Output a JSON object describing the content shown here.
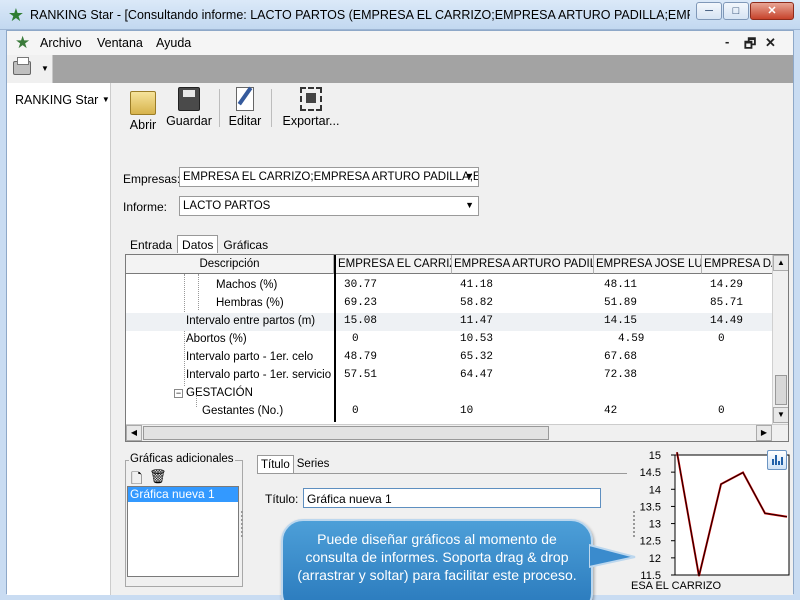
{
  "window": {
    "title": "RANKING Star - [Consultando informe: LACTO PARTOS (EMPRESA EL CARRIZO;EMPRESA ARTURO PADILLA;EMPRESA JOS...",
    "minimize": "─",
    "maximize": "□",
    "close": "✕"
  },
  "menu": {
    "items": [
      "Archivo",
      "Ventana",
      "Ayuda"
    ],
    "mdi_restore": "🗗",
    "mdi_close": "✕"
  },
  "left_panel": {
    "label": "RANKING Star"
  },
  "toolbar": {
    "open_label": "Abrir",
    "save_label": "Guardar",
    "edit_label": "Editar",
    "export_label": "Exportar..."
  },
  "form": {
    "empresas_label": "Empresas:",
    "empresas_value": "EMPRESA EL CARRIZO;EMPRESA ARTURO PADILLA;EMPRI",
    "informe_label": "Informe:",
    "informe_value": "LACTO PARTOS"
  },
  "tabs": [
    "Entrada",
    "Datos",
    "Gráficas"
  ],
  "active_tab": "Datos",
  "grid": {
    "columns": [
      "Descripción",
      "EMPRESA EL CARRIZO",
      "EMPRESA ARTURO PADILLA",
      "EMPRESA JOSE LUIS",
      "EMPRESA DAN"
    ],
    "rows": [
      {
        "desc": "Machos (%)",
        "values": [
          "30.77",
          "41.18",
          "48.11",
          "14.29"
        ]
      },
      {
        "desc": "Hembras (%)",
        "values": [
          "69.23",
          "58.82",
          "51.89",
          "85.71"
        ]
      },
      {
        "desc": "Intervalo entre partos (m)",
        "values": [
          "15.08",
          "11.47",
          "14.15",
          "14.49"
        ]
      },
      {
        "desc": "Abortos (%)",
        "values": [
          "0",
          "10.53",
          "4.59",
          "0"
        ]
      },
      {
        "desc": "Intervalo parto - 1er. celo",
        "values": [
          "48.79",
          "65.32",
          "67.68",
          ""
        ]
      },
      {
        "desc": "Intervalo parto - 1er. servicio",
        "values": [
          "57.51",
          "64.47",
          "72.38",
          ""
        ]
      },
      {
        "desc": "GESTACIÓN",
        "values": [
          "",
          "",
          "",
          ""
        ]
      },
      {
        "desc": "Gestantes (No.)",
        "values": [
          "0",
          "10",
          "42",
          "0"
        ]
      }
    ]
  },
  "extra_charts": {
    "group_label": "Gráficas adicionales",
    "items": [
      "Gráfica nueva 1"
    ]
  },
  "props": {
    "tabs": [
      "Título",
      "Series"
    ],
    "title_label": "Título:",
    "title_value": "Gráfica nueva 1"
  },
  "callout": {
    "text": "Puede diseñar gráficos al momento de consulta de informes. Soporta drag & drop (arrastrar y soltar) para facilitar este proceso."
  },
  "chart_data": {
    "type": "line",
    "y_ticks": [
      "15",
      "14.5",
      "14",
      "13.5",
      "13",
      "12.5",
      "12",
      "11.5"
    ],
    "ylim": [
      11.5,
      15
    ],
    "x_label": "ESA EL CARRIZO",
    "series": [
      {
        "color": "#c00000",
        "values": [
          15.08,
          11.47,
          14.15,
          14.49,
          13.3,
          13.2
        ]
      }
    ]
  },
  "colors": {
    "selection": "#3399ff",
    "callout_fill": "#3b8cd0",
    "chart_line": "#c00000"
  }
}
